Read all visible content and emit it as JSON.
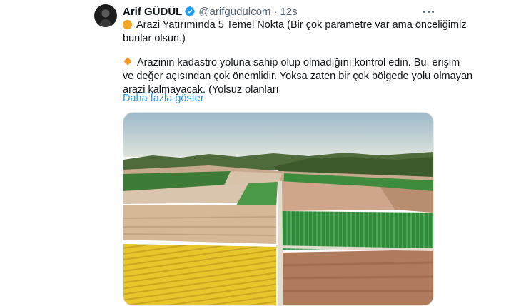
{
  "tweet": {
    "author_name": "Arif GÜDÜL",
    "handle": "@arifgudulcom",
    "separator": "·",
    "time": "12s",
    "lines": [
      "Arazi Yatırımında 5 Temel Nokta (Bir çok parametre var ama önceliğimiz",
      "bunlar olsun.)",
      "Arazinin kadastro yoluna sahip olup olmadığını kontrol edin. Bu, erişim",
      "ve değer açısından çok önemlidir. Yoksa zaten bir çok bölgede yolu olmayan",
      "arazi kalmayacak. (Yolsuz olanları"
    ],
    "show_more": "Daha fazla göster"
  },
  "icons": {
    "verified": "verified-badge-icon",
    "more": "more-options-icon",
    "bullet1": "orange-circle-emoji",
    "bullet2": "orange-diamond-emoji"
  },
  "colors": {
    "link": "#1d9bf0",
    "verified": "#1d9bf0",
    "secondary_text": "#536471"
  }
}
